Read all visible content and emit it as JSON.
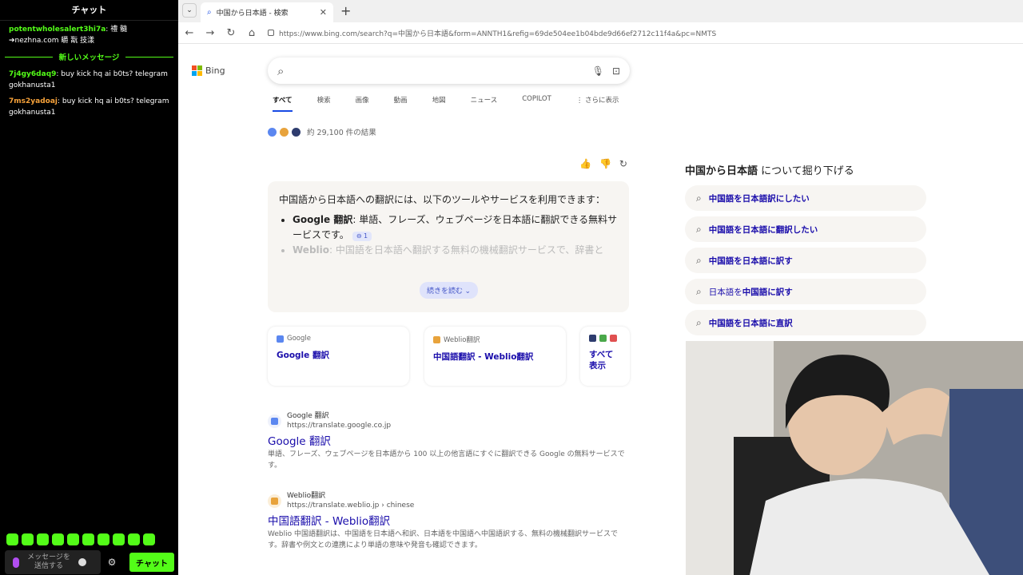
{
  "chat": {
    "title": "チャット",
    "messages_top": [
      {
        "user": "potentwholesalert3hi7a",
        "user_color": "#53fc18",
        "text": ": 禮 髓 ➔nezhna.com 皭 翫 技漾"
      }
    ],
    "new_messages_label": "新しいメッセージ",
    "messages_bottom": [
      {
        "user": "7j4gy6daq9",
        "user_color": "#53fc18",
        "text": ": buy kick hq ai b0ts? telegram gokhanusta1"
      },
      {
        "user": "7ms2yadoaj",
        "user_color": "#f7a23a",
        "text": ": buy kick hq ai b0ts? telegram gokhanusta1"
      }
    ],
    "input_placeholder": "メッセージを送信する",
    "send_label": "チャット",
    "settings_icon": "⚙",
    "emote_count": 10,
    "accent": "#53fc18"
  },
  "browser": {
    "tab_title": "中国から日本語 - 検索",
    "tab_close": "✕",
    "new_tab": "+",
    "tab_list": "⌄",
    "nav": {
      "back": "←",
      "forward": "→",
      "reload": "↻",
      "home": "⌂"
    },
    "url": "https://www.bing.com/search?q=中国から日本語&form=ANNTH1&refig=69de504ee1b04bde9d66ef2712c11f4a&pc=NMTS"
  },
  "bing": {
    "logo_text": "Bing",
    "search_value": "",
    "icons": {
      "search": "⌕",
      "mic": "🎙",
      "visual": "⊡",
      "like": "👍",
      "dislike": "👎",
      "share": "↻",
      "related_search": "⌕"
    },
    "scopes": [
      "すべて",
      "検索",
      "画像",
      "動画",
      "地図",
      "ニュース",
      "COPILOT",
      "⋮ さらに表示"
    ],
    "result_count": "約 29,100 件の結果",
    "copilot": {
      "intro": "中国語から日本語への翻訳には、以下のツールやサービスを利用できます：",
      "items": [
        {
          "bold": "Google 翻訳",
          "text": ": 単語、フレーズ、ウェブページを日本語に翻訳できる無料サービスです。",
          "cite": "⊖ 1"
        },
        {
          "bold": "Weblio",
          "text": ": 中国語を日本語へ翻訳する無料の機械翻訳サービスで、辞書と"
        }
      ],
      "read_more": "続きを読む ⌄"
    },
    "source_cards": [
      {
        "site": "Google",
        "title": "Google 翻訳"
      },
      {
        "site": "Weblio翻訳",
        "title": "中国語翻訳 - Weblio翻訳"
      },
      {
        "site": "",
        "title": "すべて表示"
      }
    ],
    "results": [
      {
        "site_name": "Google 翻訳",
        "site_url": "https://translate.google.co.jp",
        "title": "Google 翻訳",
        "snippet": "単語、フレーズ、ウェブページを日本語から 100 以上の他言語にすぐに翻訳できる Google の無料サービスです。"
      },
      {
        "site_name": "Weblio翻訳",
        "site_url": "https://translate.weblio.jp › chinese",
        "title": "中国語翻訳 - Weblio翻訳",
        "snippet": "Weblio 中国語翻訳は、中国語を日本語へ和訳、日本語を中国語へ中国語訳する、無料の機械翻訳サービスです。辞書や例文との連携により単語の意味や発音も確認できます。"
      }
    ],
    "related": {
      "heading_bold": "中国から日本語",
      "heading_rest": " について掘り下げる",
      "items": [
        {
          "bold": "中国語を日本語訳にしたい",
          "rest": ""
        },
        {
          "bold": "中国語を日本語に翻訳したい",
          "rest": ""
        },
        {
          "bold": "中国語を日本語に訳す",
          "rest": ""
        },
        {
          "pre": "日本語を",
          "bold": "中国語に訳す",
          "rest": ""
        },
        {
          "bold": "中国語を日本語に直訳",
          "rest": ""
        }
      ]
    },
    "colors": {
      "link": "#1a0dab",
      "accent": "#174ae4"
    }
  }
}
